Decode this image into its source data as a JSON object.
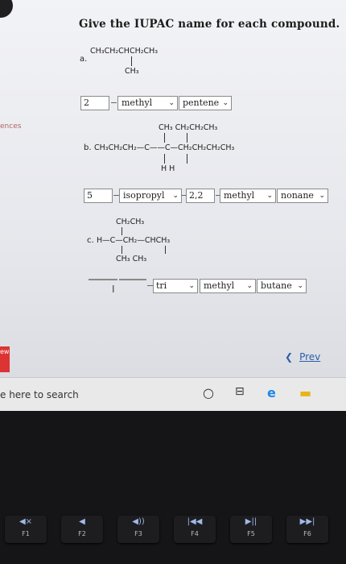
{
  "question": {
    "title": "Give the IUPAC name for each compound."
  },
  "sidebar": {
    "text": "ences",
    "badge": "ew"
  },
  "part_a": {
    "label": "a.",
    "formula_main": "CH₃CH₂CHCH₂CH₃",
    "formula_sub": "CH₃",
    "answer": {
      "locant": "2",
      "substituent": "methyl",
      "parent": "pentene"
    }
  },
  "part_b": {
    "label": "b.",
    "formula_top": "CH₃ CH₂CH₂CH₃",
    "formula_main": "CH₃CH₂CH₂—C——C—CH₂CH₂CH₂CH₃",
    "formula_bottom": "H    H",
    "answer": {
      "locant1": "5",
      "substituent1": "isopropyl",
      "locant2": "2,2",
      "substituent2": "methyl",
      "parent": "nonane"
    }
  },
  "part_c": {
    "label": "c.",
    "formula_top": "CH₂CH₃",
    "formula_main": "H—C—CH₂—CHCH₃",
    "formula_bottom": "CH₃      CH₃",
    "answer": {
      "locant1": "",
      "locant2": "",
      "prefix": "tri",
      "substituent": "methyl",
      "parent": "butane"
    }
  },
  "nav": {
    "prev_label": "Prev"
  },
  "taskbar": {
    "search_text": "e here to search"
  },
  "keys": [
    {
      "symbol": "◀×",
      "label": "F1"
    },
    {
      "symbol": "◀",
      "label": "F2"
    },
    {
      "symbol": "◀))",
      "label": "F3"
    },
    {
      "symbol": "|◀◀",
      "label": "F4"
    },
    {
      "symbol": "▶||",
      "label": "F5"
    },
    {
      "symbol": "▶▶|",
      "label": "F6"
    }
  ]
}
